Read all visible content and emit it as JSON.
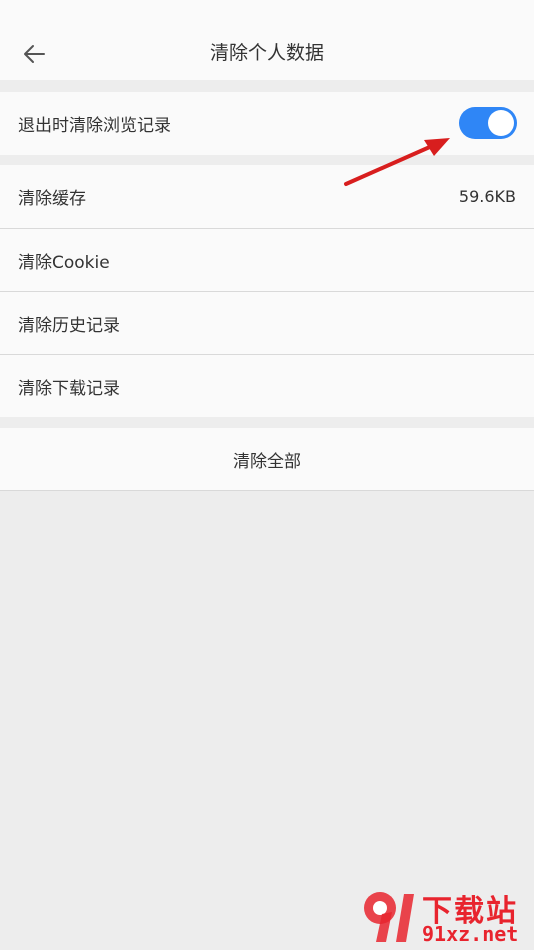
{
  "header": {
    "title": "清除个人数据"
  },
  "settings": {
    "exit_clear": {
      "label": "退出时清除浏览记录",
      "enabled": true,
      "toggle_color": "#2f86f6"
    },
    "items": [
      {
        "label": "清除缓存",
        "value": "59.6KB"
      },
      {
        "label": "清除Cookie",
        "value": ""
      },
      {
        "label": "清除历史记录",
        "value": ""
      },
      {
        "label": "清除下载记录",
        "value": ""
      }
    ],
    "clear_all_label": "清除全部"
  },
  "annotation": {
    "arrow_color": "#d81e1e"
  },
  "watermark": {
    "logo_text": "下载站",
    "domain": "91xz.net",
    "color": "#e8242e"
  }
}
